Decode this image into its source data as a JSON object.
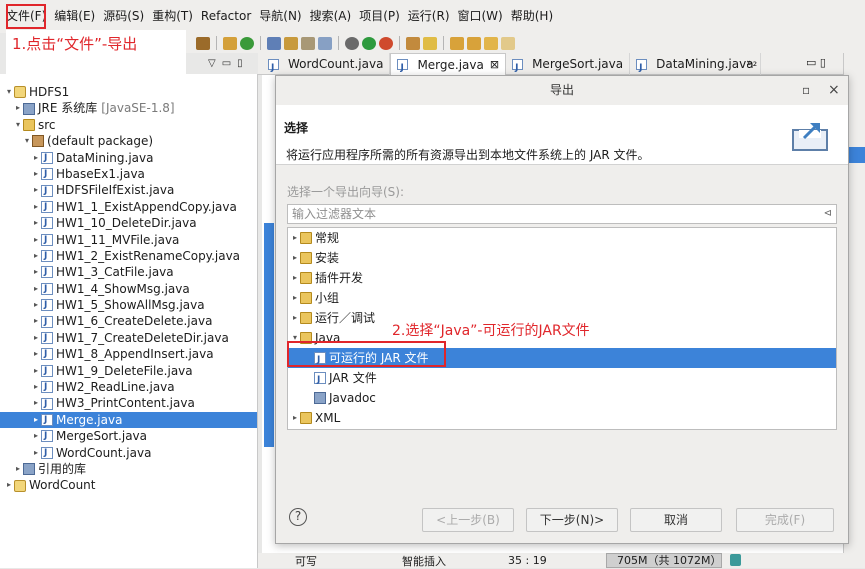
{
  "menubar": {
    "items": [
      "文件(F)",
      "编辑(E)",
      "源码(S)",
      "重构(T)",
      "Refactor",
      "导航(N)",
      "搜索(A)",
      "项目(P)",
      "运行(R)",
      "窗口(W)",
      "帮助(H)"
    ]
  },
  "annotations": {
    "step1": "1.点击“文件”-导出",
    "step2": "2.选择“Java”-可运行的JAR文件"
  },
  "explorer": {
    "view_menu": [
      "▽",
      "▭",
      "▯"
    ],
    "items": [
      {
        "label": "HDFS1",
        "suffix": "",
        "depth": 0,
        "twisty": "▾",
        "icon": "project-icon"
      },
      {
        "label": "JRE 系统库",
        "suffix": "[JavaSE-1.8]",
        "depth": 1,
        "twisty": "▸",
        "icon": "library-icon"
      },
      {
        "label": "src",
        "suffix": "",
        "depth": 1,
        "twisty": "▾",
        "icon": "folder-icon"
      },
      {
        "label": "(default package)",
        "suffix": "",
        "depth": 2,
        "twisty": "▾",
        "icon": "package-icon"
      },
      {
        "label": "DataMining.java",
        "suffix": "",
        "depth": 3,
        "twisty": "▸",
        "icon": "java-file-icon"
      },
      {
        "label": "HbaseEx1.java",
        "suffix": "",
        "depth": 3,
        "twisty": "▸",
        "icon": "java-file-icon"
      },
      {
        "label": "HDFSFileIfExist.java",
        "suffix": "",
        "depth": 3,
        "twisty": "▸",
        "icon": "java-file-icon"
      },
      {
        "label": "HW1_1_ExistAppendCopy.java",
        "suffix": "",
        "depth": 3,
        "twisty": "▸",
        "icon": "java-file-icon"
      },
      {
        "label": "HW1_10_DeleteDir.java",
        "suffix": "",
        "depth": 3,
        "twisty": "▸",
        "icon": "java-file-icon"
      },
      {
        "label": "HW1_11_MVFile.java",
        "suffix": "",
        "depth": 3,
        "twisty": "▸",
        "icon": "java-file-icon"
      },
      {
        "label": "HW1_2_ExistRenameCopy.java",
        "suffix": "",
        "depth": 3,
        "twisty": "▸",
        "icon": "java-file-icon"
      },
      {
        "label": "HW1_3_CatFile.java",
        "suffix": "",
        "depth": 3,
        "twisty": "▸",
        "icon": "java-file-icon"
      },
      {
        "label": "HW1_4_ShowMsg.java",
        "suffix": "",
        "depth": 3,
        "twisty": "▸",
        "icon": "java-file-icon"
      },
      {
        "label": "HW1_5_ShowAllMsg.java",
        "suffix": "",
        "depth": 3,
        "twisty": "▸",
        "icon": "java-file-icon"
      },
      {
        "label": "HW1_6_CreateDelete.java",
        "suffix": "",
        "depth": 3,
        "twisty": "▸",
        "icon": "java-file-icon"
      },
      {
        "label": "HW1_7_CreateDeleteDir.java",
        "suffix": "",
        "depth": 3,
        "twisty": "▸",
        "icon": "java-file-icon"
      },
      {
        "label": "HW1_8_AppendInsert.java",
        "suffix": "",
        "depth": 3,
        "twisty": "▸",
        "icon": "java-file-icon"
      },
      {
        "label": "HW1_9_DeleteFile.java",
        "suffix": "",
        "depth": 3,
        "twisty": "▸",
        "icon": "java-file-icon"
      },
      {
        "label": "HW2_ReadLine.java",
        "suffix": "",
        "depth": 3,
        "twisty": "▸",
        "icon": "java-file-icon"
      },
      {
        "label": "HW3_PrintContent.java",
        "suffix": "",
        "depth": 3,
        "twisty": "▸",
        "icon": "java-file-icon"
      },
      {
        "label": "Merge.java",
        "suffix": "",
        "depth": 3,
        "twisty": "▸",
        "icon": "java-file-icon",
        "selected": true
      },
      {
        "label": "MergeSort.java",
        "suffix": "",
        "depth": 3,
        "twisty": "▸",
        "icon": "java-file-icon"
      },
      {
        "label": "WordCount.java",
        "suffix": "",
        "depth": 3,
        "twisty": "▸",
        "icon": "java-file-icon"
      },
      {
        "label": "引用的库",
        "suffix": "",
        "depth": 1,
        "twisty": "▸",
        "icon": "library-icon"
      },
      {
        "label": "WordCount",
        "suffix": "",
        "depth": 0,
        "twisty": "▸",
        "icon": "project-icon"
      }
    ]
  },
  "editor": {
    "tabs": [
      {
        "label": "WordCount.java",
        "active": false,
        "close": ""
      },
      {
        "label": "Merge.java",
        "active": true,
        "close": "⊠"
      },
      {
        "label": "MergeSort.java",
        "active": false,
        "close": ""
      },
      {
        "label": "DataMining.java",
        "active": false,
        "close": ""
      }
    ],
    "overflow": "»₂",
    "min_max": "▭ ▯"
  },
  "dialog": {
    "title": "导出",
    "maximize": "▫",
    "close": "×",
    "banner_heading": "选择",
    "banner_desc": "将运行应用程序所需的所有资源导出到本地文件系统上的 JAR 文件。",
    "wizard_label": "选择一个导出向导(S):",
    "filter_placeholder": "输入过滤器文本",
    "filter_clear": "⊲",
    "wizard_tree": [
      {
        "label": "常规",
        "depth": 0,
        "twisty": "▸",
        "icon": "folder-icon"
      },
      {
        "label": "安装",
        "depth": 0,
        "twisty": "▸",
        "icon": "folder-icon"
      },
      {
        "label": "插件开发",
        "depth": 0,
        "twisty": "▸",
        "icon": "folder-icon"
      },
      {
        "label": "小组",
        "depth": 0,
        "twisty": "▸",
        "icon": "folder-icon"
      },
      {
        "label": "运行／调试",
        "depth": 0,
        "twisty": "▸",
        "icon": "folder-icon"
      },
      {
        "label": "Java",
        "depth": 0,
        "twisty": "▾",
        "icon": "folder-icon"
      },
      {
        "label": "可运行的 JAR 文件",
        "depth": 1,
        "twisty": "",
        "icon": "runnable-jar-icon",
        "selected": true
      },
      {
        "label": "JAR 文件",
        "depth": 1,
        "twisty": "",
        "icon": "jar-icon"
      },
      {
        "label": "Javadoc",
        "depth": 1,
        "twisty": "",
        "icon": "javadoc-icon"
      },
      {
        "label": "XML",
        "depth": 0,
        "twisty": "▸",
        "icon": "folder-icon"
      }
    ],
    "help": "?",
    "buttons": {
      "back": "<上一步(B)",
      "next": "下一步(N)>",
      "cancel": "取消",
      "finish": "完成(F)"
    }
  },
  "statusbar": {
    "writable": "可写",
    "insert_mode": "智能插入",
    "position": "35 : 19",
    "memory": "705M（共 1072M）"
  },
  "colors": {
    "selection": "#3c83d9",
    "annotation": "#e0262b"
  }
}
